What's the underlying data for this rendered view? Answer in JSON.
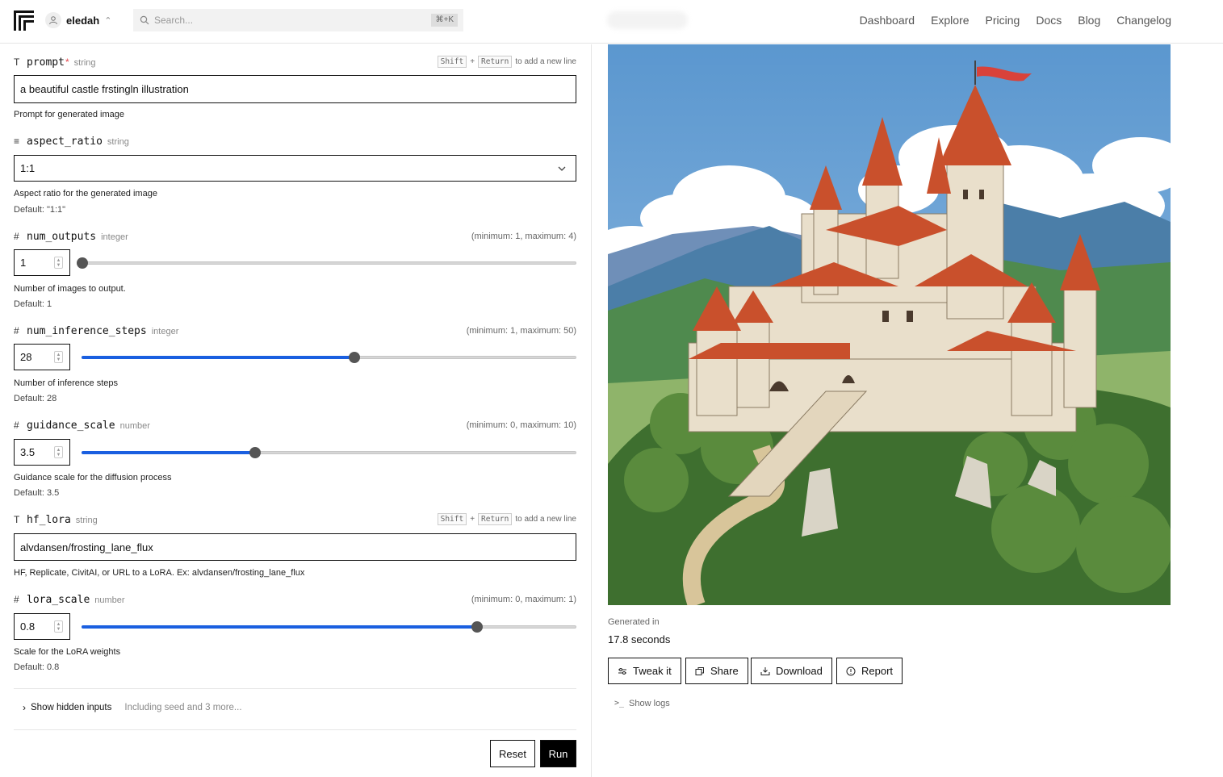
{
  "header": {
    "username": "eledah",
    "search_placeholder": "Search...",
    "search_shortcut": "⌘+K",
    "nav": [
      "Dashboard",
      "Explore",
      "Pricing",
      "Docs",
      "Blog",
      "Changelog"
    ]
  },
  "inputs": {
    "prompt": {
      "name": "prompt",
      "required_mark": "*",
      "type": "string",
      "value": "a beautiful castle frstingln illustration",
      "description": "Prompt for generated image",
      "hint_key1": "Shift",
      "hint_plus": "+",
      "hint_key2": "Return",
      "hint_text": "to add a new line"
    },
    "aspect_ratio": {
      "name": "aspect_ratio",
      "type": "string",
      "value": "1:1",
      "description": "Aspect ratio for the generated image",
      "default": "Default: \"1:1\""
    },
    "num_outputs": {
      "name": "num_outputs",
      "type": "integer",
      "value": "1",
      "range": "(minimum: 1, maximum: 4)",
      "description": "Number of images to output.",
      "default": "Default: 1",
      "min": 1,
      "max": 4,
      "current": 1
    },
    "num_inference_steps": {
      "name": "num_inference_steps",
      "type": "integer",
      "value": "28",
      "range": "(minimum: 1, maximum: 50)",
      "description": "Number of inference steps",
      "default": "Default: 28",
      "min": 1,
      "max": 50,
      "current": 28
    },
    "guidance_scale": {
      "name": "guidance_scale",
      "type": "number",
      "value": "3.5",
      "range": "(minimum: 0, maximum: 10)",
      "description": "Guidance scale for the diffusion process",
      "default": "Default: 3.5",
      "min": 0,
      "max": 10,
      "current": 3.5
    },
    "hf_lora": {
      "name": "hf_lora",
      "type": "string",
      "value": "alvdansen/frosting_lane_flux",
      "description": "HF, Replicate, CivitAI, or URL to a LoRA. Ex: alvdansen/frosting_lane_flux",
      "hint_key1": "Shift",
      "hint_plus": "+",
      "hint_key2": "Return",
      "hint_text": "to add a new line"
    },
    "lora_scale": {
      "name": "lora_scale",
      "type": "number",
      "value": "0.8",
      "range": "(minimum: 0, maximum: 1)",
      "description": "Scale for the LoRA weights",
      "default": "Default: 0.8",
      "min": 0,
      "max": 1,
      "current": 0.8
    }
  },
  "hidden_inputs": {
    "label": "Show hidden inputs",
    "sub": "Including seed and 3 more..."
  },
  "actions": {
    "reset": "Reset",
    "run": "Run"
  },
  "output": {
    "generated_label": "Generated in",
    "generated_value": "17.8 seconds",
    "buttons": {
      "tweak": "Tweak it",
      "share": "Share",
      "download": "Download",
      "report": "Report"
    },
    "show_logs": "Show logs"
  },
  "colors": {
    "accent": "#1a5fe0",
    "slider_thumb": "#555555",
    "run_bg": "#000000"
  }
}
